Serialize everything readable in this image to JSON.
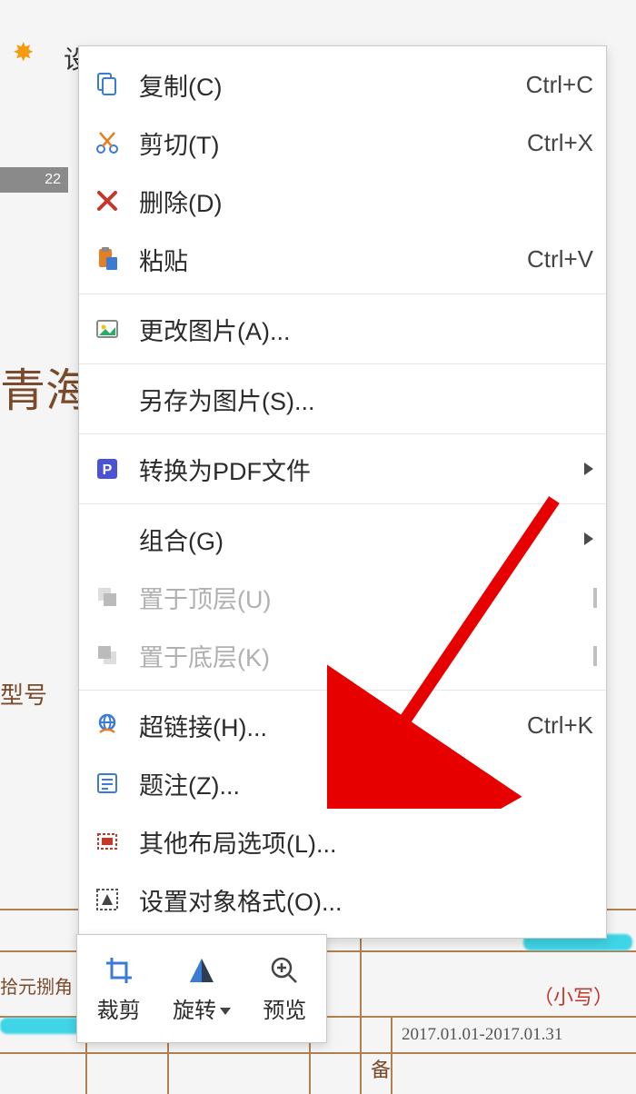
{
  "background": {
    "ruler_mark": "22",
    "doc_title_fragment": "青海",
    "label_fragment": "型号",
    "bottom_left_text": "拾元捌角",
    "bottom_right_text": "（小写）",
    "date_range": "2017.01.01-2017.01.31",
    "bei_char": "备",
    "topbar_text": "设置透明色   颜色"
  },
  "menu": {
    "copy": {
      "label": "复制(C)",
      "shortcut": "Ctrl+C"
    },
    "cut": {
      "label": "剪切(T)",
      "shortcut": "Ctrl+X"
    },
    "delete": {
      "label": "删除(D)",
      "shortcut": ""
    },
    "paste": {
      "label": "粘贴",
      "shortcut": "Ctrl+V"
    },
    "change_image": {
      "label": "更改图片(A)..."
    },
    "save_as_image": {
      "label": "另存为图片(S)..."
    },
    "to_pdf": {
      "label": "转换为PDF文件"
    },
    "group": {
      "label": "组合(G)"
    },
    "bring_front": {
      "label": "置于顶层(U)"
    },
    "send_back": {
      "label": "置于底层(K)"
    },
    "hyperlink": {
      "label": "超链接(H)...",
      "shortcut": "Ctrl+K"
    },
    "caption": {
      "label": "题注(Z)..."
    },
    "layout_options": {
      "label": "其他布局选项(L)..."
    },
    "format_object": {
      "label": "设置对象格式(O)..."
    }
  },
  "toolbar": {
    "crop": "裁剪",
    "rotate": "旋转",
    "preview": "预览"
  }
}
